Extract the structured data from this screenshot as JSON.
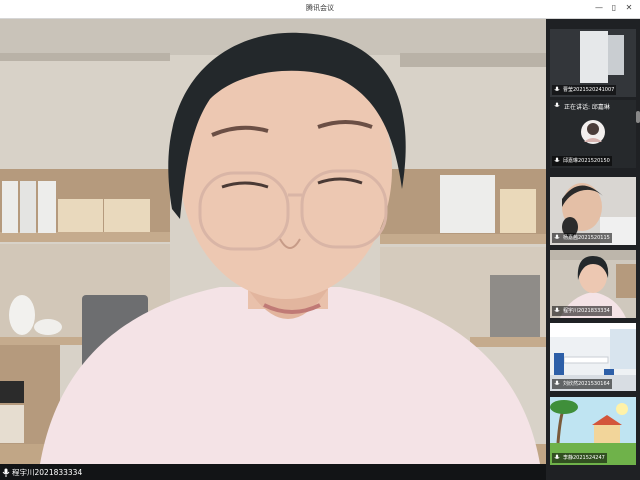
{
  "window": {
    "title": "腾讯会议",
    "minimize": "—",
    "restore": "▯",
    "close": "✕"
  },
  "main_video": {
    "participant_name": "程宇川2021833334"
  },
  "participants": [
    {
      "name": "曹莹2021520241007"
    },
    {
      "name": "邱嘉琳2021520150",
      "status": "正在讲话: 邱嘉琳"
    },
    {
      "name": "杨嘉茜2021520115"
    },
    {
      "name": "程宇川2021833334"
    },
    {
      "name": "刘欣然2021530164"
    },
    {
      "name": "李静2021524247"
    }
  ],
  "colors": {
    "titlebar_bg": "#ffffff",
    "panel_bg": "#1f2124",
    "name_bar_bg": "#121416"
  }
}
